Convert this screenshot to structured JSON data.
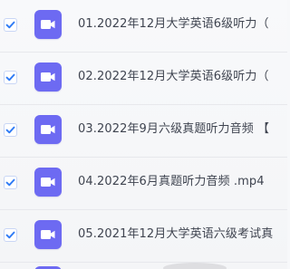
{
  "file_list": {
    "items": [
      {
        "name": "01.2022年12月大学英语6级听力（",
        "checked": true,
        "icon": "video-file-icon"
      },
      {
        "name": "02.2022年12月大学英语6级听力（",
        "checked": true,
        "icon": "video-file-icon"
      },
      {
        "name": "03.2022年9月六级真题听力音频 【",
        "checked": true,
        "icon": "video-file-icon"
      },
      {
        "name": "04.2022年6月真题听力音频 .mp4",
        "checked": true,
        "icon": "video-file-icon"
      },
      {
        "name": "05.2021年12月大学英语六级考试真",
        "checked": true,
        "icon": "video-file-icon"
      }
    ]
  },
  "colors": {
    "icon_purple": "#6d6af2",
    "check_blue": "#2f7bf5",
    "text": "#3f4450"
  }
}
